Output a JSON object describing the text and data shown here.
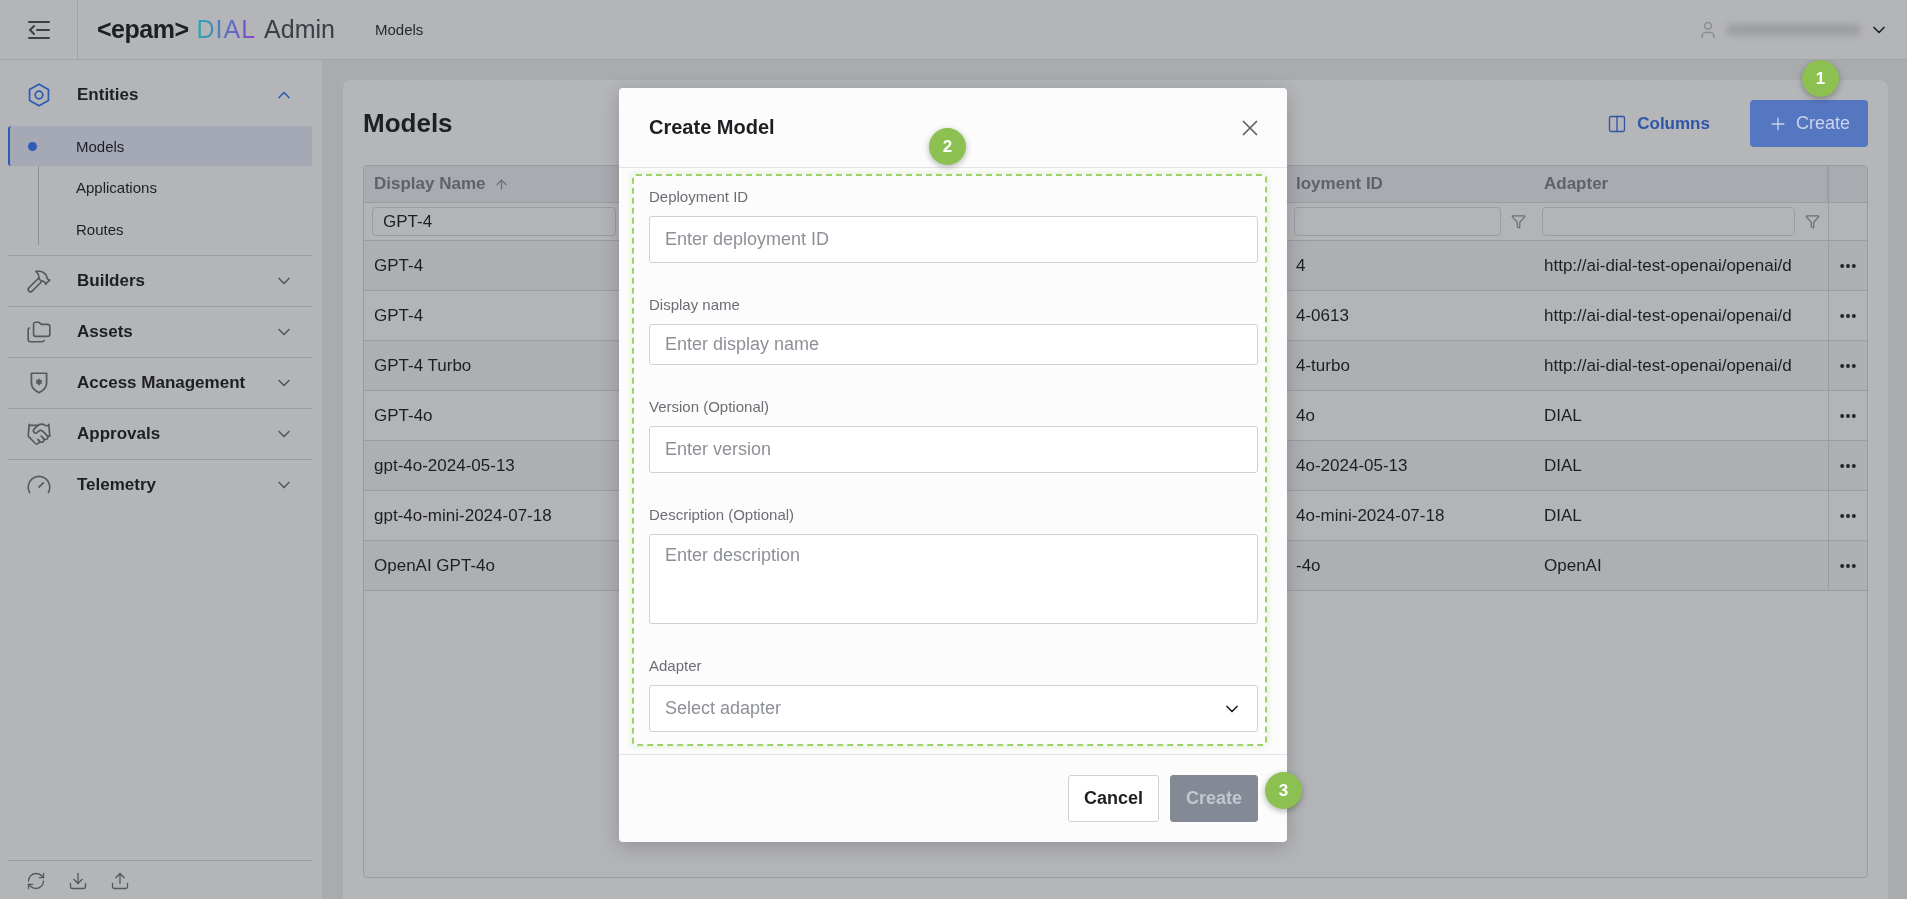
{
  "header": {
    "logo": {
      "brand": "<epam>",
      "product": "DIAL",
      "suffix": "Admin"
    },
    "breadcrumb": "Models"
  },
  "sidebar": {
    "sections": [
      {
        "label": "Entities",
        "expanded": true,
        "children": [
          {
            "label": "Models",
            "selected": true
          },
          {
            "label": "Applications",
            "selected": false
          },
          {
            "label": "Routes",
            "selected": false
          }
        ]
      },
      {
        "label": "Builders",
        "expanded": false
      },
      {
        "label": "Assets",
        "expanded": false
      },
      {
        "label": "Access Management",
        "expanded": false
      },
      {
        "label": "Approvals",
        "expanded": false
      },
      {
        "label": "Telemetry",
        "expanded": false
      }
    ]
  },
  "page": {
    "title": "Models",
    "columns_button": "Columns",
    "create_button": "Create"
  },
  "table": {
    "columns": [
      {
        "label": "Display Name",
        "filter_value": "GPT-4"
      },
      {
        "label": "loyment ID"
      },
      {
        "label": "Adapter"
      }
    ],
    "rows": [
      {
        "cells": [
          "GPT-4",
          "4",
          "http://ai-dial-test-openai/openai/d"
        ]
      },
      {
        "cells": [
          "GPT-4",
          "4-0613",
          "http://ai-dial-test-openai/openai/d"
        ]
      },
      {
        "cells": [
          "GPT-4 Turbo",
          "4-turbo",
          "http://ai-dial-test-openai/openai/d"
        ]
      },
      {
        "cells": [
          "GPT-4o",
          "4o",
          "DIAL"
        ]
      },
      {
        "cells": [
          "gpt-4o-2024-05-13",
          "4o-2024-05-13",
          "DIAL"
        ]
      },
      {
        "cells": [
          "gpt-4o-mini-2024-07-18",
          "4o-mini-2024-07-18",
          "DIAL"
        ]
      },
      {
        "cells": [
          "OpenAI GPT-4o",
          "-4o",
          "OpenAI"
        ]
      }
    ]
  },
  "modal": {
    "title": "Create Model",
    "fields": [
      {
        "kind": "input",
        "label": "Deployment ID",
        "placeholder": "Enter deployment ID"
      },
      {
        "kind": "input",
        "label": "Display name",
        "placeholder": "Enter display name"
      },
      {
        "kind": "input",
        "label": "Version (Optional)",
        "placeholder": "Enter version"
      },
      {
        "kind": "textarea",
        "label": "Description (Optional)",
        "placeholder": "Enter description"
      },
      {
        "kind": "select",
        "label": "Adapter",
        "placeholder": "Select adapter"
      }
    ],
    "buttons": [
      {
        "label": "Cancel",
        "kind": "secondary",
        "disabled": false
      },
      {
        "label": "Create",
        "kind": "primary",
        "disabled": true
      }
    ]
  },
  "annotations": [
    {
      "label": "1"
    },
    {
      "label": "2"
    },
    {
      "label": "3"
    }
  ]
}
